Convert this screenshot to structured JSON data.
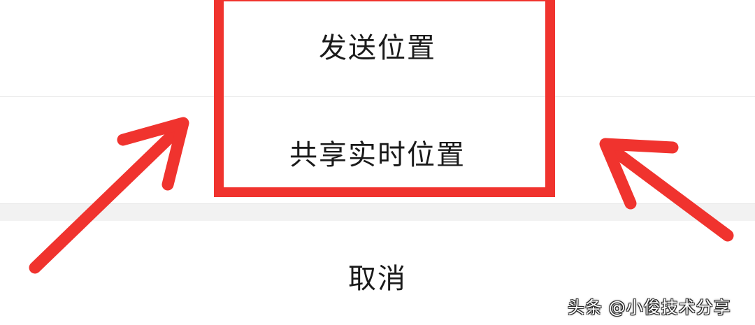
{
  "action_sheet": {
    "send_location": "发送位置",
    "share_live_location": "共享实时位置",
    "cancel": "取消"
  },
  "watermark": {
    "text": "头条 @小俊技术分享"
  },
  "annotation": {
    "highlight_color": "#f0332e",
    "arrow_color": "#f0332e"
  }
}
